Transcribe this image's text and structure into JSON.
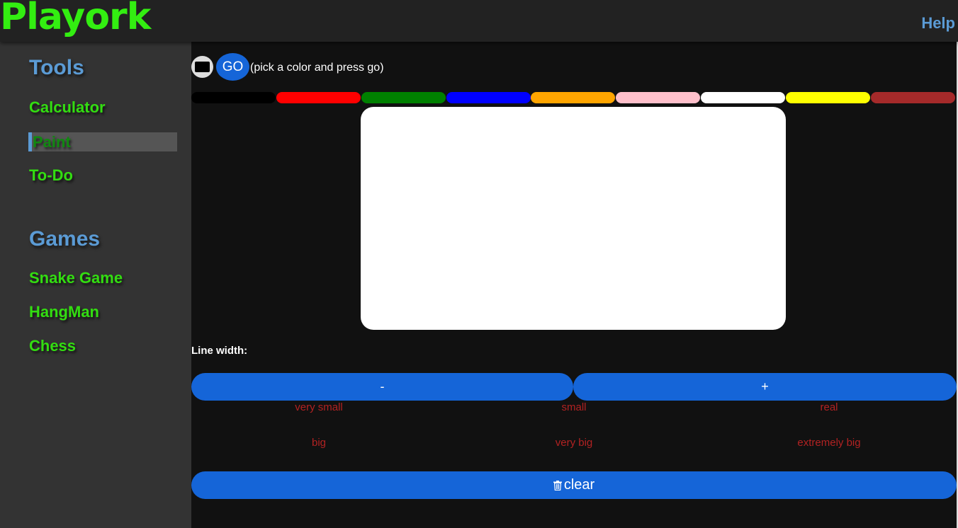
{
  "header": {
    "logo": "Playork",
    "help_label": "Help"
  },
  "sidebar": {
    "tools_heading": "Tools",
    "tools": [
      {
        "label": "Calculator"
      },
      {
        "label": "Paint",
        "active": true
      },
      {
        "label": "To-Do"
      }
    ],
    "games_heading": "Games",
    "games": [
      {
        "label": "Snake Game"
      },
      {
        "label": "HangMan"
      },
      {
        "label": "Chess"
      }
    ]
  },
  "toolbar": {
    "go_label": "GO",
    "hint": "(pick a color and press go)"
  },
  "palette": [
    "#000000",
    "#ff0000",
    "#008000",
    "#0000ff",
    "#ffa500",
    "#ffc0cb",
    "#ffffff",
    "#ffff00",
    "#a52a2a"
  ],
  "line_width": {
    "label": "Line width:",
    "minus_label": "-",
    "plus_label": "+",
    "sizes": [
      "very small",
      "small",
      "real",
      "big",
      "very big",
      "extremely big"
    ]
  },
  "clear_label": "clear",
  "icons": {
    "clear": "trash-icon",
    "square": "square-icon"
  },
  "colors": {
    "accent_blue": "#1565d8",
    "heading_blue": "#5b9bd5",
    "link_green": "#33dd11",
    "size_red": "#b22222"
  }
}
